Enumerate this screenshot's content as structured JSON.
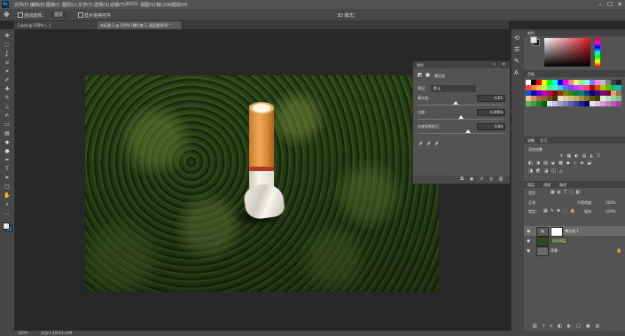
{
  "menu": [
    "文件(F)",
    "编辑(E)",
    "图像(I)",
    "图层(L)",
    "文字(Y)",
    "选择(S)",
    "滤镜(T)",
    "3D(D)",
    "视图(V)",
    "窗口(W)",
    "帮助(H)"
  ],
  "window_controls": {
    "minimize": "–",
    "maximize": "☐",
    "close": "✕"
  },
  "options": {
    "auto_select_label": "自动选择：",
    "auto_select_value": "图层",
    "transform_label": "显示变换控件",
    "mode_label": "3D 模式："
  },
  "tabs": [
    {
      "label": "1.psd @ 100% (…)"
    },
    {
      "label": "未标题-1 @ 100% (曝光度 1, 图层蒙版/8) *"
    }
  ],
  "properties": {
    "panel_title": "属性",
    "layer_type": "曝光度",
    "preset_label": "预设：",
    "preset_value": "默认",
    "exposure_label": "曝光度：",
    "exposure_value": "-0.61",
    "offset_label": "位移：",
    "offset_value": "0.0000",
    "gamma_label": "灰度系数校正：",
    "gamma_value": "0.84",
    "sliders": {
      "exposure": 0.44,
      "offset": 0.5,
      "gamma": 0.58
    }
  },
  "color_panel": {
    "title": "颜色",
    "fg": "#e8e8e8",
    "bg": "#111111",
    "hue_color": "#e01820"
  },
  "swatches_panel": {
    "title": "色板",
    "colors": [
      "#ffffff",
      "#000000",
      "#ff0000",
      "#ffff00",
      "#00ff00",
      "#00ffff",
      "#0000ff",
      "#ff00ff",
      "#ff8080",
      "#ffff80",
      "#80ff80",
      "#80ffff",
      "#8080ff",
      "#ff80ff",
      "#c0c0c0",
      "#808080",
      "#404040",
      "#202020",
      "#ff4040",
      "#ff8040",
      "#ffc040",
      "#c0ff40",
      "#40ff80",
      "#40ffc0",
      "#40c0ff",
      "#4080ff",
      "#8040ff",
      "#c040ff",
      "#ff40c0",
      "#ff4080",
      "#c00000",
      "#c06000",
      "#c0c000",
      "#60c000",
      "#00c060",
      "#00c0c0",
      "#0060c0",
      "#0000c0",
      "#6000c0",
      "#c000c0",
      "#c00060",
      "#800000",
      "#804000",
      "#808000",
      "#408000",
      "#008040",
      "#008080",
      "#004080",
      "#000080",
      "#400080",
      "#800080",
      "#800040",
      "#e0a070",
      "#a07050",
      "#f0c0a0",
      "#d09070",
      "#b06040",
      "#906030",
      "#705020",
      "#503010",
      "#f0e0c0",
      "#e0d0a0",
      "#d0c080",
      "#c0b060",
      "#a09040",
      "#807020",
      "#605010",
      "#404000",
      "#e0f0e0",
      "#c0e0c0",
      "#a0d0a0",
      "#80c080",
      "#60b060",
      "#40a040",
      "#208020",
      "#006000",
      "#e0e0f0",
      "#c0c0e0",
      "#a0a0d0",
      "#8080c0",
      "#6060b0",
      "#4040a0",
      "#202080",
      "#000060",
      "#f0e0f0",
      "#e0c0e0",
      "#d0a0d0",
      "#c080c0",
      "#b060b0",
      "#a040a0"
    ]
  },
  "adjust_panel": {
    "tabs": [
      "调整",
      "学习"
    ],
    "label": "添加调整"
  },
  "layers_panel": {
    "tabs": [
      "图层",
      "通道",
      "路径"
    ],
    "kind_label": "类型",
    "blend_mode": "正常",
    "opacity_label": "不透明度：",
    "opacity_value": "100%",
    "lock_label": "锁定：",
    "fill_label": "填充：",
    "fill_value": "100%",
    "layers": [
      {
        "name": "曝光度 1",
        "selected": true
      },
      {
        "name": "组合图层",
        "selected": false
      },
      {
        "name": "背景",
        "selected": false
      }
    ]
  },
  "status": {
    "zoom": "100%",
    "doc": "文档:1.16M/3.42M"
  }
}
